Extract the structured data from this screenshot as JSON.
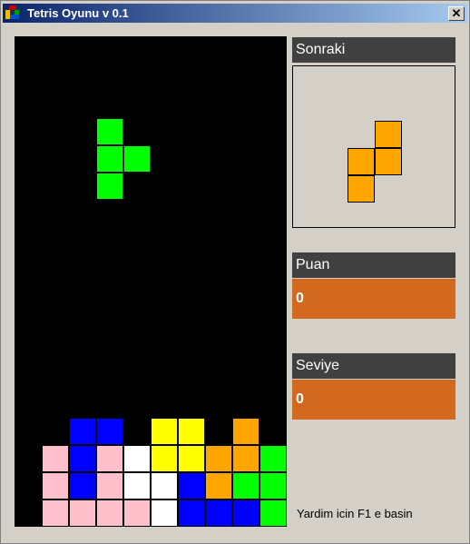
{
  "window": {
    "title": "Tetris Oyunu v 0.1",
    "close_label": "✕"
  },
  "board": {
    "cols": 10,
    "rows": 18,
    "active_piece": {
      "shape": "T",
      "color": "#00ff00",
      "cells": [
        [
          3,
          3
        ],
        [
          3,
          4
        ],
        [
          4,
          4
        ],
        [
          3,
          5
        ]
      ]
    },
    "settled": [
      [
        2,
        14,
        "#0000ff"
      ],
      [
        3,
        14,
        "#0000ff"
      ],
      [
        5,
        14,
        "#ffff00"
      ],
      [
        6,
        14,
        "#ffff00"
      ],
      [
        8,
        14,
        "#ffa500"
      ],
      [
        1,
        15,
        "#ffc0cb"
      ],
      [
        2,
        15,
        "#0000ff"
      ],
      [
        3,
        15,
        "#ffc0cb"
      ],
      [
        4,
        15,
        "#ffffff"
      ],
      [
        5,
        15,
        "#ffff00"
      ],
      [
        6,
        15,
        "#ffff00"
      ],
      [
        7,
        15,
        "#ffa500"
      ],
      [
        8,
        15,
        "#ffa500"
      ],
      [
        9,
        15,
        "#00ff00"
      ],
      [
        1,
        16,
        "#ffc0cb"
      ],
      [
        2,
        16,
        "#0000ff"
      ],
      [
        3,
        16,
        "#ffc0cb"
      ],
      [
        4,
        16,
        "#ffffff"
      ],
      [
        5,
        16,
        "#ffffff"
      ],
      [
        6,
        16,
        "#0000ff"
      ],
      [
        7,
        16,
        "#ffa500"
      ],
      [
        8,
        16,
        "#00ff00"
      ],
      [
        9,
        16,
        "#00ff00"
      ],
      [
        1,
        17,
        "#ffc0cb"
      ],
      [
        2,
        17,
        "#ffc0cb"
      ],
      [
        3,
        17,
        "#ffc0cb"
      ],
      [
        4,
        17,
        "#ffc0cb"
      ],
      [
        5,
        17,
        "#ffffff"
      ],
      [
        6,
        17,
        "#0000ff"
      ],
      [
        7,
        17,
        "#0000ff"
      ],
      [
        8,
        17,
        "#0000ff"
      ],
      [
        9,
        17,
        "#00ff00"
      ]
    ]
  },
  "next": {
    "label": "Sonraki",
    "shape": "S",
    "color": "#ffa500",
    "cells": [
      [
        1,
        0
      ],
      [
        0,
        1
      ],
      [
        1,
        1
      ],
      [
        0,
        2
      ]
    ]
  },
  "score": {
    "label": "Puan",
    "value": "0"
  },
  "level": {
    "label": "Seviye",
    "value": "0"
  },
  "help_text": "Yardim icin F1 e basin"
}
